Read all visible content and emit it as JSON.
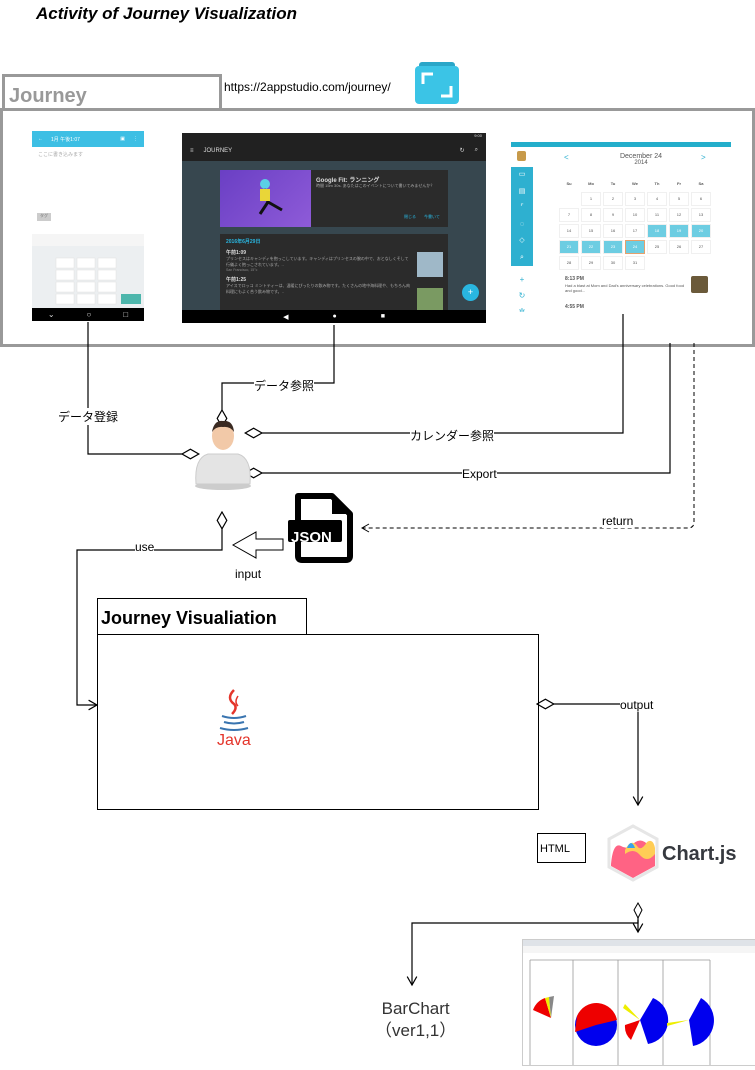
{
  "title": "Activity of Journey Visualization",
  "journey_section": {
    "label": "Journey",
    "url": "https://2appstudio.com/journey/",
    "app_icon": "journey-app-icon"
  },
  "phone_screen": {
    "header_title": "1月 午後1:07",
    "placeholder": "ここに書き込みます",
    "tag": "タグ"
  },
  "tablet_screen": {
    "app_title": "JOURNEY",
    "status_time": "9:00",
    "card_title": "Google Fit: ランニング",
    "card_text": "時間 15m 30s. あなたはこのイベントについて書いてみませんか？",
    "card_actions": [
      "閉じる",
      "今書いて"
    ],
    "date_header": "2016年6月29日",
    "entries": [
      {
        "time": "午前1:09",
        "text": "プリンセスはキャンディを抱っこしています。キャンディはプリンセスの腕の中で、おとなしくそして行儀よく抱っこされています。..",
        "location": "San Francisco, 15°c"
      },
      {
        "time": "午前1:25",
        "text": "アイスでロッコ ミントティーは、温暖にぴったりの飲み物です。たくさんの地中海料理や、もちろん肉料理にもよく合う飲み物です。.."
      }
    ],
    "fab": "+"
  },
  "desktop_screen": {
    "month": "December 24",
    "year": "2014",
    "prev": "<",
    "next": ">",
    "weekdays": [
      "Su",
      "Mo",
      "Tu",
      "We",
      "Th",
      "Fr",
      "Sa"
    ],
    "days": [
      "",
      "1",
      "2",
      "3",
      "4",
      "5",
      "6",
      "7",
      "8",
      "9",
      "10",
      "11",
      "12",
      "13",
      "14",
      "15",
      "16",
      "17",
      "18",
      "19",
      "20",
      "21",
      "22",
      "23",
      "24",
      "25",
      "26",
      "27",
      "28",
      "29",
      "30",
      "31"
    ],
    "highlighted": [
      "18",
      "19",
      "20",
      "21",
      "22",
      "23"
    ],
    "today": "24",
    "entries": [
      {
        "time": "8:13 PM",
        "text": "Had a blast at Mom and Dad's anniversary celebrations. Good food and good..."
      },
      {
        "time": "4:55 PM",
        "text": ""
      }
    ]
  },
  "connectors": {
    "data_ref": "データ参照",
    "data_register": "データ登録",
    "calendar_ref": "カレンダー参照",
    "export": "Export",
    "return": "return",
    "use": "use",
    "input": "input",
    "output": "output"
  },
  "json_icon_label": "JSON",
  "visualization_box": {
    "title": "Journey Visualiation",
    "logo_text": "Java"
  },
  "html_box": "HTML",
  "chartjs_label": "Chart.js",
  "barchart": {
    "line1": "BarChart",
    "line2": "（ver1,1）"
  },
  "colors": {
    "frame_gray": "#999999",
    "journey_blue": "#3dbfe4",
    "calendar_blue": "#2eb0d0",
    "pie_red": "#ff0000",
    "pie_blue": "#0000ee",
    "pie_yellow": "#ffff00"
  }
}
